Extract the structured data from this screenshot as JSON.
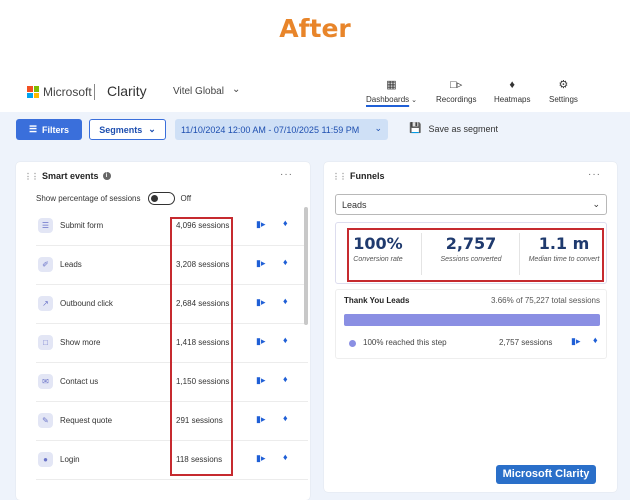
{
  "banner": "After",
  "header": {
    "brand": "Microsoft",
    "app_name": "Clarity",
    "project": "Vitel Global",
    "nav": [
      {
        "label": "Dashboards",
        "icon": "dashboard-icon",
        "active": true
      },
      {
        "label": "Recordings",
        "icon": "recordings-icon"
      },
      {
        "label": "Heatmaps",
        "icon": "heatmaps-icon"
      },
      {
        "label": "Settings",
        "icon": "settings-icon"
      }
    ],
    "logo_colors": [
      "#f25022",
      "#7fba00",
      "#00a4ef",
      "#ffb900"
    ]
  },
  "toolbar": {
    "filters_label": "Filters",
    "segments_label": "Segments",
    "date_range": "11/10/2024 12:00 AM - 07/10/2025 11:59 PM",
    "save_segment_label": "Save as segment"
  },
  "smart_events": {
    "title": "Smart events",
    "toggle_label": "Show percentage of sessions",
    "toggle_state": "Off",
    "events": [
      {
        "name": "Submit form",
        "count": "4,096 sessions",
        "icon": "form-icon"
      },
      {
        "name": "Leads",
        "count": "3,208 sessions",
        "icon": "leads-icon"
      },
      {
        "name": "Outbound click",
        "count": "2,684 sessions",
        "icon": "outbound-icon"
      },
      {
        "name": "Show more",
        "count": "1,418 sessions",
        "icon": "show-more-icon"
      },
      {
        "name": "Contact us",
        "count": "1,150 sessions",
        "icon": "contact-icon"
      },
      {
        "name": "Request quote",
        "count": "291 sessions",
        "icon": "quote-icon"
      },
      {
        "name": "Login",
        "count": "118 sessions",
        "icon": "login-icon"
      }
    ]
  },
  "funnels": {
    "title": "Funnels",
    "selected": "Leads",
    "kpis": [
      {
        "value": "100%",
        "label": "Conversion rate"
      },
      {
        "value": "2,757",
        "label": "Sessions converted"
      },
      {
        "value": "1.1 m",
        "label": "Median time to convert"
      }
    ],
    "step": {
      "name": "Thank You Leads",
      "total": "3.66% of 75,227 total sessions",
      "reached": "100% reached this step",
      "sessions": "2,757 sessions",
      "fill_fraction": 1.0
    }
  },
  "watermark": "Microsoft Clarity"
}
